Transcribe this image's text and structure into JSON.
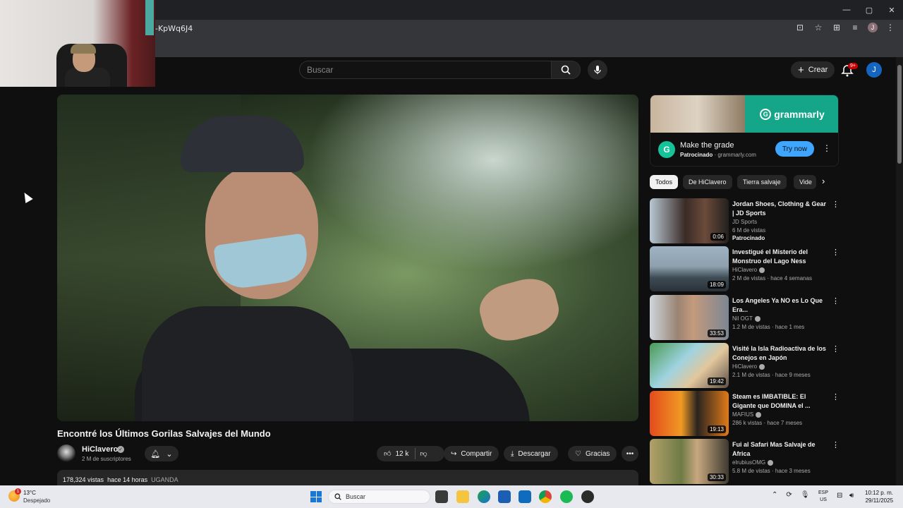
{
  "browser": {
    "url_fragment": "-KpWq6J4",
    "profile_initial": "J",
    "window_controls": [
      "—",
      "▢",
      "✕"
    ]
  },
  "header": {
    "search_placeholder": "Buscar",
    "create_label": "Crear",
    "notification_count": "9+",
    "avatar_initial": "J"
  },
  "video": {
    "title": "Encontré los Últimos Gorilas Salvajes del Mundo",
    "channel": "HiClavero",
    "subscribers": "2 M de suscriptores",
    "likes": "12 k",
    "share_label": "Compartir",
    "download_label": "Descargar",
    "thanks_label": "Gracias",
    "views": "178,324 vistas",
    "age": "hace 14 horas",
    "location_tag": "UGANDA"
  },
  "ad": {
    "brand": "grammarly",
    "logo_letter": "G",
    "title": "Make the grade",
    "sponsored": "Patrocinado",
    "domain": "grammarly.com",
    "cta": "Try now"
  },
  "chips": [
    "Todos",
    "De HiClavero",
    "Tierra salvaje",
    "Vide"
  ],
  "recommended": [
    {
      "title": "Jordan Shoes, Clothing & Gear | JD Sports",
      "channel": "JD Sports",
      "meta": "6 M de vistas",
      "tag": "Patrocinado",
      "duration": "0:06",
      "verified": false
    },
    {
      "title": "Investigué el Misterio del Monstruo del Lago Ness",
      "channel": "HiClavero",
      "meta": "2 M de vistas · hace 4 semanas",
      "tag": "",
      "duration": "18:09",
      "verified": true
    },
    {
      "title": "Los Angeles Ya NO es Lo Que Era...",
      "channel": "Nil OGT",
      "meta": "1.2 M de vistas · hace 1 mes",
      "tag": "",
      "duration": "33:53",
      "verified": true
    },
    {
      "title": "Visité la Isla Radioactiva de los Conejos en Japón",
      "channel": "HiClavero",
      "meta": "2.1 M de vistas · hace 9 meses",
      "tag": "",
      "duration": "19:42",
      "verified": true
    },
    {
      "title": "Steam es IMBATIBLE: El Gigante que DOMINA el ...",
      "channel": "MAFIUS",
      "meta": "286 k vistas · hace 7 meses",
      "tag": "",
      "duration": "19:13",
      "verified": true
    },
    {
      "title": "Fui al Safari Mas Salvaje de Africa",
      "channel": "elrubiusOMG",
      "meta": "5.8 M de vistas · hace 3 meses",
      "tag": "",
      "duration": "30:33",
      "verified": true
    }
  ],
  "taskbar": {
    "weather_badge": "1",
    "temperature": "13°C",
    "weather": "Despejado",
    "search_label": "Buscar",
    "lang_top": "ESP",
    "lang_bottom": "US",
    "time": "10:12 p. m.",
    "date": "29/11/2025"
  },
  "colors": {
    "background": "#0f0f0f",
    "accent_blue": "#3ea6ff",
    "grammarly_green": "#15a689",
    "badge_red": "#cc0000"
  }
}
